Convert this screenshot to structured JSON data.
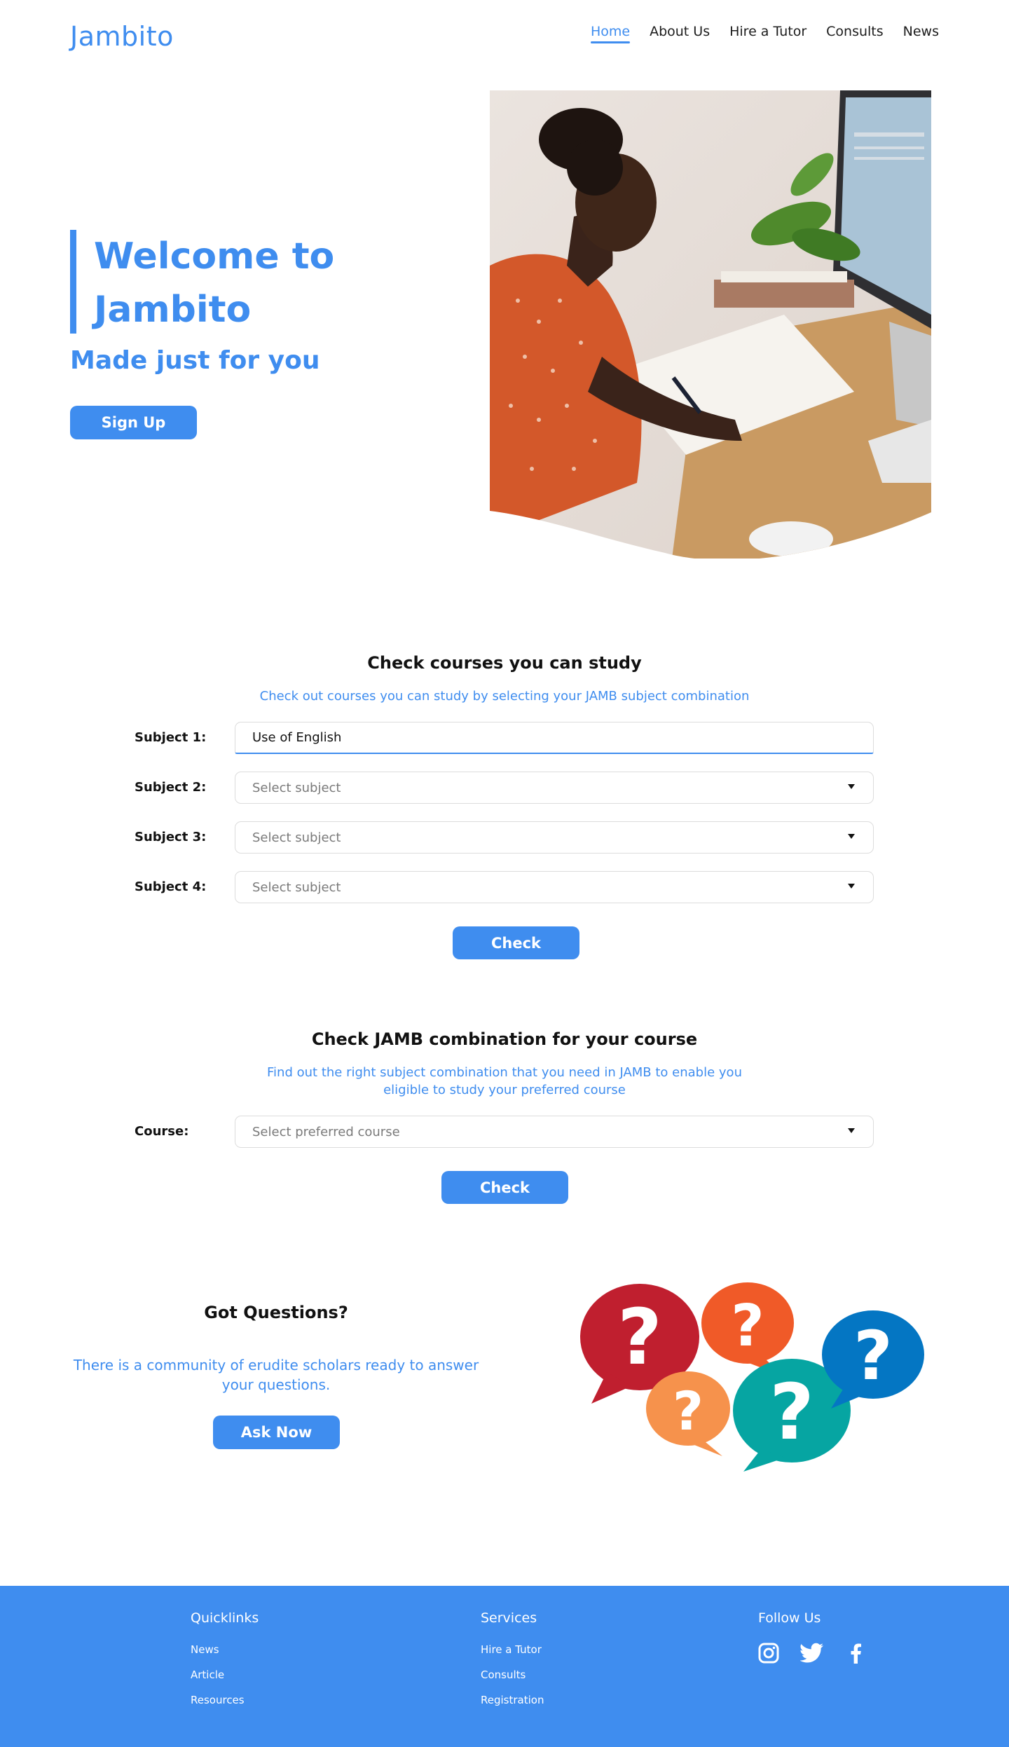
{
  "header": {
    "logo": "Jambito",
    "nav": [
      {
        "label": "Home",
        "active": true
      },
      {
        "label": "About Us",
        "active": false
      },
      {
        "label": "Hire a Tutor",
        "active": false
      },
      {
        "label": "Consults",
        "active": false
      },
      {
        "label": "News",
        "active": false
      }
    ]
  },
  "hero": {
    "title": "Welcome to Jambito",
    "subtitle": "Made just for you",
    "signup_label": "Sign Up"
  },
  "courses": {
    "title": "Check courses you can study",
    "description": "Check out courses you can study by selecting your JAMB subject combination",
    "subjects": [
      {
        "label": "Subject 1:",
        "value": "Use of English",
        "placeholder": ""
      },
      {
        "label": "Subject 2:",
        "value": "",
        "placeholder": "Select subject"
      },
      {
        "label": "Subject 3:",
        "value": "",
        "placeholder": "Select subject"
      },
      {
        "label": "Subject 4:",
        "value": "",
        "placeholder": "Select subject"
      }
    ],
    "check_label": "Check"
  },
  "combination": {
    "title": "Check JAMB combination for your course",
    "description": "Find out the right subject combination that you need in JAMB to enable you eligible to study your preferred course",
    "course_label": "Course:",
    "course_placeholder": "Select preferred course",
    "check_label": "Check"
  },
  "questions": {
    "title": "Got Questions?",
    "description": "There is a community of erudite scholars ready to answer your questions.",
    "ask_label": "Ask Now"
  },
  "footer": {
    "quicklinks": {
      "title": "Quicklinks",
      "links": [
        "News",
        "Article",
        "Resources"
      ]
    },
    "services": {
      "title": "Services",
      "links": [
        "Hire a Tutor",
        "Consults",
        "Registration"
      ]
    },
    "follow": {
      "title": "Follow Us",
      "icons": [
        "instagram-icon",
        "twitter-icon",
        "facebook-icon"
      ]
    }
  },
  "colors": {
    "accent": "#3f8def",
    "text": "#111111",
    "footer_bg": "#3f8def"
  }
}
